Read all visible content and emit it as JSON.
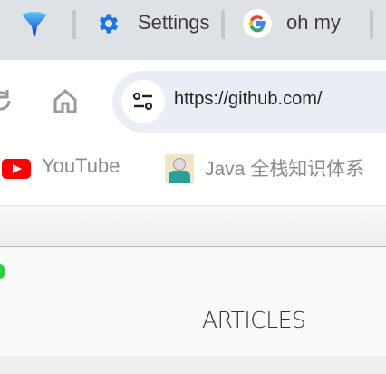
{
  "tabs": [
    {
      "icon": "funnel-icon",
      "label": ""
    },
    {
      "icon": "gear-icon",
      "label": "Settings"
    },
    {
      "icon": "google-icon",
      "label": "oh my"
    }
  ],
  "toolbar": {
    "url": "https://github.com/"
  },
  "bookmarks": [
    {
      "icon": "youtube-icon",
      "label": "YouTube"
    },
    {
      "icon": "avatar-icon",
      "label": "Java 全栈知识体系"
    }
  ],
  "page": {
    "nav_label": "ARTICLES"
  },
  "colors": {
    "tabbar": "#dee1e6",
    "omnibox": "#e9edf4",
    "accent": "#1a73e8",
    "status": "#2ecc40"
  }
}
